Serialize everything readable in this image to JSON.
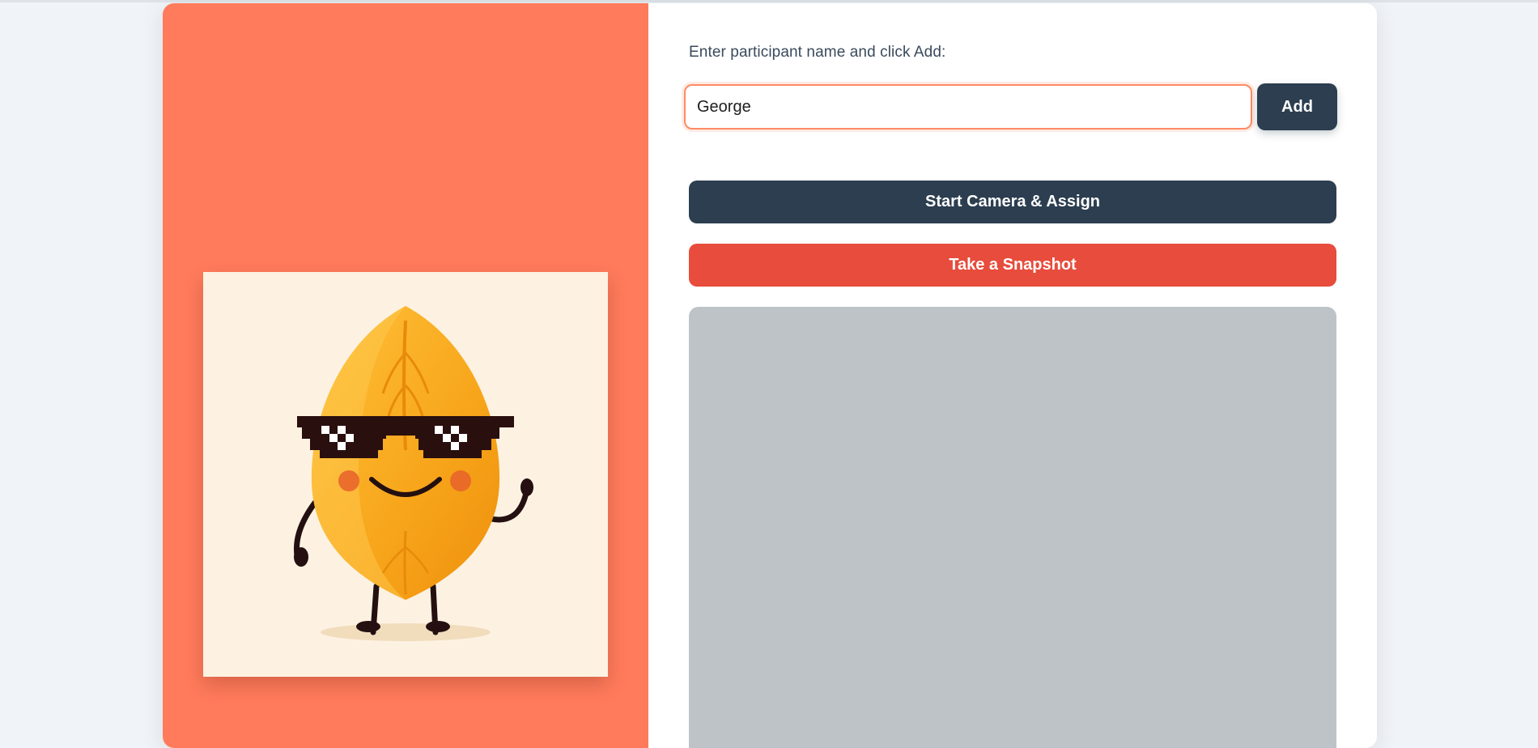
{
  "form": {
    "prompt": "Enter participant name and click Add:",
    "name_value": "George",
    "add_label": "Add"
  },
  "actions": {
    "start_camera_label": "Start Camera & Assign",
    "snapshot_label": "Take a Snapshot"
  },
  "mascot": {
    "icon": "almond-mascot-with-pixel-sunglasses"
  },
  "colors": {
    "accent": "#ff7b5c",
    "primary_button": "#2c3e50",
    "snapshot_button": "#e74c3c",
    "camera_preview": "#bdc3c7"
  }
}
